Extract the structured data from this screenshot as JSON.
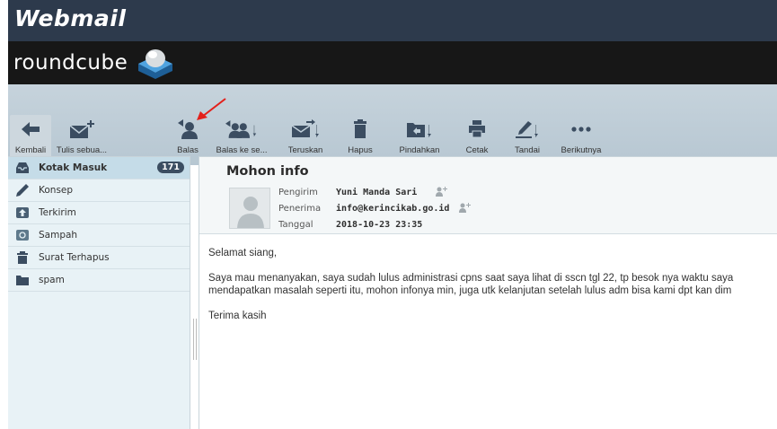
{
  "app": {
    "brand": "Webmail",
    "logo_text": "roundcube"
  },
  "toolbar": {
    "back": "Kembali",
    "compose": "Tulis sebua...",
    "reply": "Balas",
    "reply_all": "Balas ke se...",
    "forward": "Teruskan",
    "delete": "Hapus",
    "move": "Pindahkan",
    "print": "Cetak",
    "mark": "Tandai",
    "more": "Berikutnya"
  },
  "folders": [
    {
      "label": "Kotak Masuk",
      "icon": "inbox-icon",
      "selected": true,
      "count": "171"
    },
    {
      "label": "Konsep",
      "icon": "pencil-icon"
    },
    {
      "label": "Terkirim",
      "icon": "sent-icon"
    },
    {
      "label": "Sampah",
      "icon": "junk-icon"
    },
    {
      "label": "Surat Terhapus",
      "icon": "trash-icon"
    },
    {
      "label": "spam",
      "icon": "folder-icon"
    }
  ],
  "message": {
    "subject": "Mohon info",
    "from_label": "Pengirim",
    "from": "Yuni Manda Sari",
    "to_label": "Penerima",
    "to": "info@kerincikab.go.id",
    "date_label": "Tanggal",
    "date": "2018-10-23 23:35",
    "body": [
      "Selamat siang,",
      "Saya mau menanyakan, saya sudah lulus administrasi cpns saat saya lihat di sscn tgl 22, tp besok nya waktu saya",
      "mendapatkan masalah seperti itu, mohon infonya min, juga utk kelanjutan setelah lulus adm bisa kami dpt kan dim",
      "Terima kasih"
    ]
  },
  "colors": {
    "topbar": "#2d3a4c",
    "header": "#171717",
    "toolbar": "#c0cfd9",
    "sidebar": "#e8f2f6",
    "selected_folder": "#c5dce8",
    "annotation_arrow": "#e3201b"
  }
}
